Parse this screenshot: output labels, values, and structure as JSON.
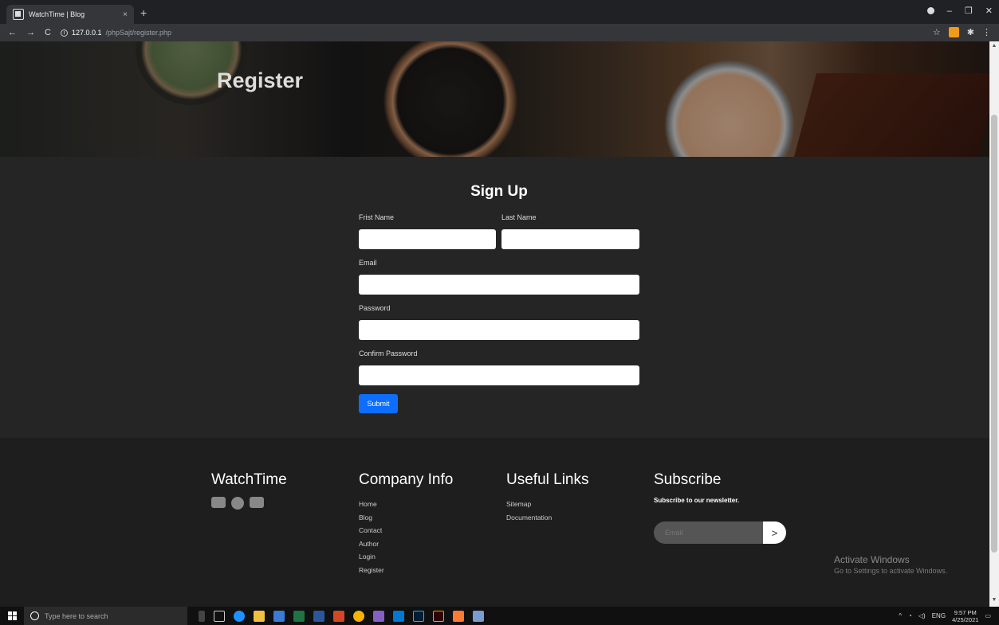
{
  "browser": {
    "tab_title": "WatchTime | Blog",
    "tab_close": "×",
    "new_tab": "+",
    "url_host": "127.0.0.1",
    "url_path": "/phpSajt/register.php",
    "nav": {
      "back": "←",
      "forward": "→",
      "reload": "C"
    },
    "window_controls": {
      "minimize": "–",
      "restore": "❐",
      "close": "✕"
    },
    "ext": {
      "star": "☆",
      "puzzle": "✱",
      "menu": "⋮"
    }
  },
  "hero": {
    "title": "Register"
  },
  "form": {
    "title": "Sign Up",
    "first_name_label": "Frist Name",
    "last_name_label": "Last Name",
    "email_label": "Email",
    "password_label": "Password",
    "confirm_password_label": "Confirm Password",
    "submit_label": "Submit"
  },
  "footer": {
    "brand": "WatchTime",
    "company_info": {
      "heading": "Company Info",
      "links": [
        "Home",
        "Blog",
        "Contact",
        "Author",
        "Login",
        "Register"
      ]
    },
    "useful_links": {
      "heading": "Useful Links",
      "links": [
        "Sitemap",
        "Documentation"
      ]
    },
    "subscribe": {
      "heading": "Subscribe",
      "subtitle": "Subscribe to our newsletter.",
      "email_placeholder": "Email",
      "submit_glyph": ">"
    }
  },
  "watermark": {
    "title": "Activate Windows",
    "subtitle": "Go to Settings to activate Windows."
  },
  "taskbar": {
    "search_placeholder": "Type here to search",
    "language": "ENG",
    "time": "9:57 PM",
    "date": "4/25/2021",
    "tray_up": "^"
  },
  "colors": {
    "submit_button": "#0d6efd",
    "page_bg": "#252525",
    "footer_bg": "#1e1e1e"
  }
}
